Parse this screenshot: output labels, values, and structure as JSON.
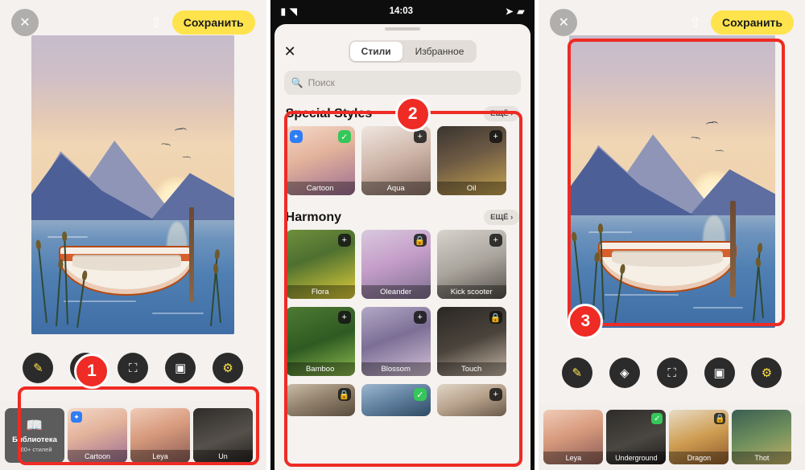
{
  "panels": [
    {
      "id": "editor-before",
      "topbar": {
        "close_icon": "close-icon",
        "share_icon": "share-icon",
        "save_label": "Сохранить"
      },
      "tools": [
        "edit-icon",
        "layers-icon",
        "mask-icon",
        "background-icon",
        "adjust-icon"
      ],
      "strip": [
        {
          "label": "Библиотека",
          "sub": "700+ стилей",
          "type": "library"
        },
        {
          "label": "Cartoon",
          "type": "style",
          "badge": "blue"
        },
        {
          "label": "Leya",
          "type": "style"
        },
        {
          "label": "Un",
          "type": "style"
        }
      ],
      "annotation": {
        "number": "1"
      }
    },
    {
      "id": "styles-sheet",
      "statusbar": {
        "carrier_icon": "cellular-icon",
        "wifi_icon": "wifi-icon",
        "time": "14:03",
        "location_icon": "location-icon",
        "battery_icon": "battery-icon"
      },
      "sheet": {
        "close_icon": "close-icon",
        "tabs": [
          {
            "label": "Стили",
            "selected": true
          },
          {
            "label": "Избранное",
            "selected": false
          }
        ],
        "search": {
          "placeholder": "Поиск",
          "icon": "search-icon"
        },
        "sections": [
          {
            "title": "Special Styles",
            "more_label": "ЕЩЁ ›",
            "cards": [
              {
                "label": "Cartoon",
                "badge": "check",
                "extra_badge": "blue",
                "thumb": "t-cartoon"
              },
              {
                "label": "Aqua",
                "badge": "plus",
                "thumb": "t-aqua"
              },
              {
                "label": "Oil",
                "badge": "plus",
                "thumb": "t-oil"
              }
            ]
          },
          {
            "title": "Harmony",
            "more_label": "ЕЩЁ ›",
            "cards": [
              {
                "label": "Flora",
                "badge": "plus",
                "thumb": "t-flora"
              },
              {
                "label": "Oleander",
                "badge": "lock",
                "thumb": "t-olea"
              },
              {
                "label": "Kick scooter",
                "badge": "plus",
                "thumb": "t-kick"
              }
            ]
          },
          {
            "title": "",
            "more_label": "",
            "cards": [
              {
                "label": "Bamboo",
                "badge": "plus",
                "thumb": "t-bamboo"
              },
              {
                "label": "Blossom",
                "badge": "plus",
                "thumb": "t-blossom"
              },
              {
                "label": "Touch",
                "badge": "lock",
                "thumb": "t-touch"
              }
            ]
          },
          {
            "title": "",
            "more_label": "",
            "cards": [
              {
                "label": "",
                "badge": "lock",
                "thumb": "t-r4a"
              },
              {
                "label": "",
                "badge": "check",
                "thumb": "t-r4b"
              },
              {
                "label": "",
                "badge": "plus",
                "thumb": "t-r4c"
              }
            ]
          }
        ]
      },
      "annotation": {
        "number": "2"
      }
    },
    {
      "id": "editor-after",
      "topbar": {
        "close_icon": "close-icon",
        "share_icon": "share-icon",
        "save_label": "Сохранить"
      },
      "tools": [
        "edit-icon",
        "layers-icon",
        "mask-icon",
        "background-icon",
        "adjust-icon"
      ],
      "strip": [
        {
          "label": "Leya",
          "type": "style"
        },
        {
          "label": "Underground",
          "type": "style",
          "badge": "check"
        },
        {
          "label": "Dragon",
          "type": "style",
          "badge": "lock"
        },
        {
          "label": "Thot",
          "type": "style"
        }
      ],
      "annotation": {
        "number": "3"
      }
    }
  ],
  "colors": {
    "annotation_red": "#ee2b24",
    "save_yellow": "#ffe34d",
    "accent_green": "#35c759",
    "accent_blue": "#2f7df6"
  }
}
